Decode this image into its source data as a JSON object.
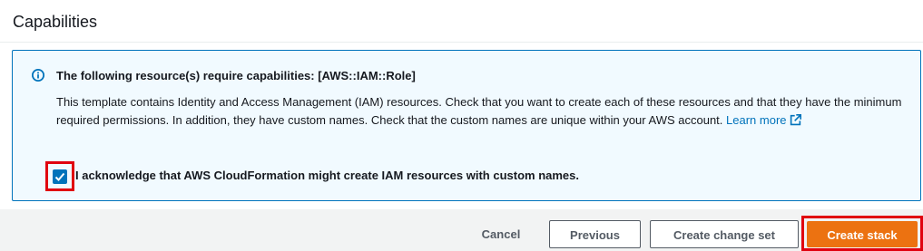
{
  "section": {
    "title": "Capabilities"
  },
  "alert": {
    "heading": "The following resource(s) require capabilities: [AWS::IAM::Role]",
    "body": "This template contains Identity and Access Management (IAM) resources. Check that you want to create each of these resources and that they have the minimum required permissions. In addition, they have custom names. Check that the custom names are unique within your AWS account.",
    "learn_more": "Learn more",
    "icon": "info-icon",
    "accent_color": "#0073bb"
  },
  "acknowledge": {
    "checked": true,
    "label": "I acknowledge that AWS CloudFormation might create IAM resources with custom names."
  },
  "footer": {
    "cancel_label": "Cancel",
    "previous_label": "Previous",
    "change_set_label": "Create change set",
    "create_stack_label": "Create stack",
    "primary_color": "#ec7211"
  }
}
